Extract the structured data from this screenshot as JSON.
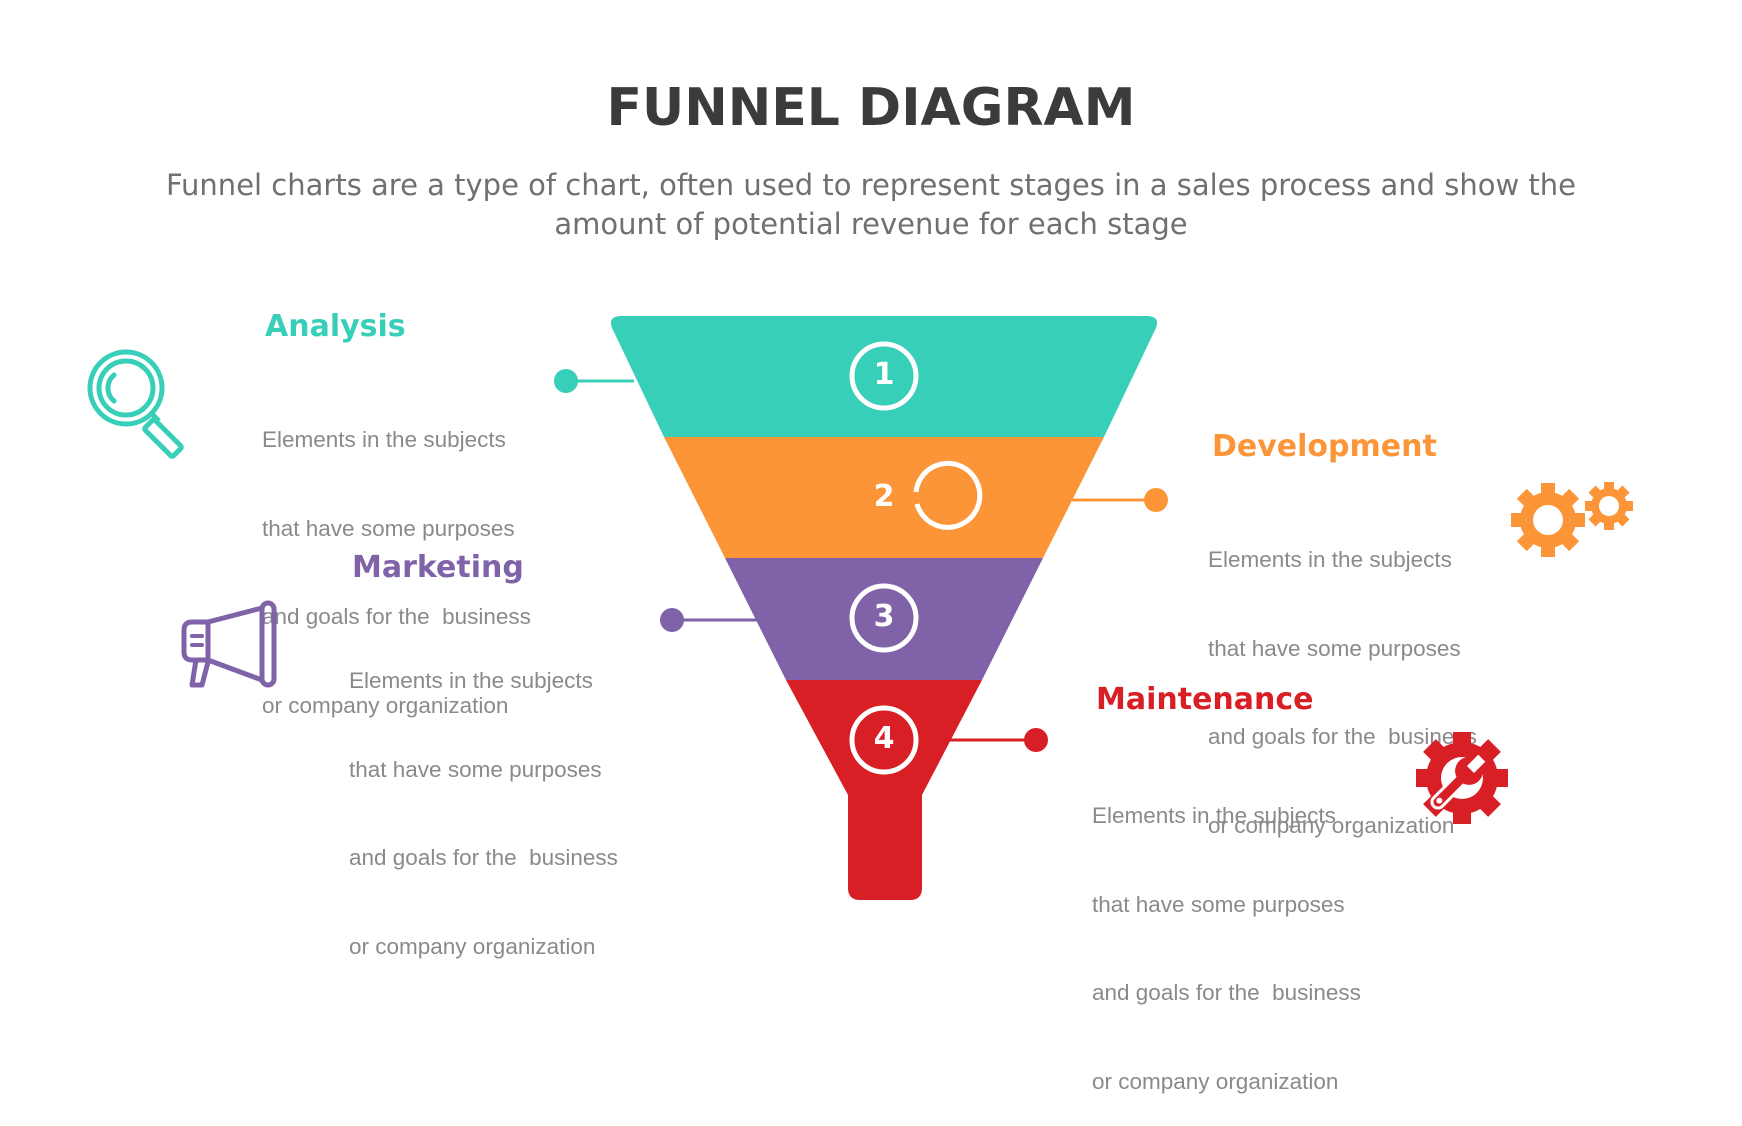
{
  "header": {
    "title": "FUNNEL DIAGRAM",
    "subtitle_line1": "Funnel charts are a type of chart, often used to represent stages in a sales process and show the",
    "subtitle_line2": "amount of potential revenue for each stage"
  },
  "colors": {
    "teal": "#37cfb8",
    "orange": "#fb9537",
    "purple": "#7f62a8",
    "red": "#d81f26",
    "title": "#3b3b3b",
    "text": "#8a8a8a"
  },
  "stages": [
    {
      "number": "1",
      "title": "Analysis",
      "color": "#37cfb8",
      "icon": "magnifying-glass-icon",
      "desc": [
        "Elements in the subjects",
        "that have some purposes",
        "and goals for the  business",
        "or company organization"
      ]
    },
    {
      "number": "2",
      "title": "Development",
      "color": "#fb9537",
      "icon": "gears-icon",
      "desc": [
        "Elements in the subjects",
        "that have some purposes",
        "and goals for the  business",
        "or company organization"
      ]
    },
    {
      "number": "3",
      "title": "Marketing",
      "color": "#7f62a8",
      "icon": "megaphone-icon",
      "desc": [
        "Elements in the subjects",
        "that have some purposes",
        "and goals for the  business",
        "or company organization"
      ]
    },
    {
      "number": "4",
      "title": "Maintenance",
      "color": "#d81f26",
      "icon": "gear-wrench-icon",
      "desc": [
        "Elements in the subjects",
        "that have some purposes",
        "and goals for the  business",
        "or company organization"
      ]
    }
  ]
}
